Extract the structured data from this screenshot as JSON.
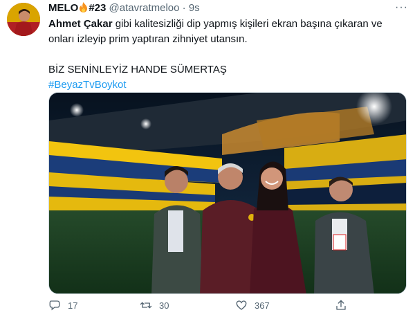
{
  "tweet": {
    "display_name": "MELO",
    "name_suffix": "#23",
    "handle": "@atavratmeloo",
    "separator": "·",
    "time": "9s",
    "mention": "Ahmet Çakar",
    "text_line1": " gibi kalitesizliği dip yapmış kişileri ekran başına çıkaran ve",
    "text_line2": "onları izleyip prim yaptıran zihniyet utansın.",
    "shout": "BİZ SENİNLEYİZ HANDE SÜMERTAŞ",
    "hashtag": "#BeyazTvBoykot",
    "more_label": "···"
  },
  "actions": {
    "reply_count": "17",
    "retweet_count": "30",
    "like_count": "367"
  },
  "icons": {
    "avatar": "avatar",
    "fire": "fire-emoji-icon",
    "more": "more-dots-icon",
    "reply": "reply-icon",
    "retweet": "retweet-icon",
    "like": "like-icon",
    "share": "share-icon"
  },
  "colors": {
    "text": "#0f1419",
    "secondary": "#536471",
    "link": "#1d9bf0",
    "fire": "#f7931e"
  }
}
